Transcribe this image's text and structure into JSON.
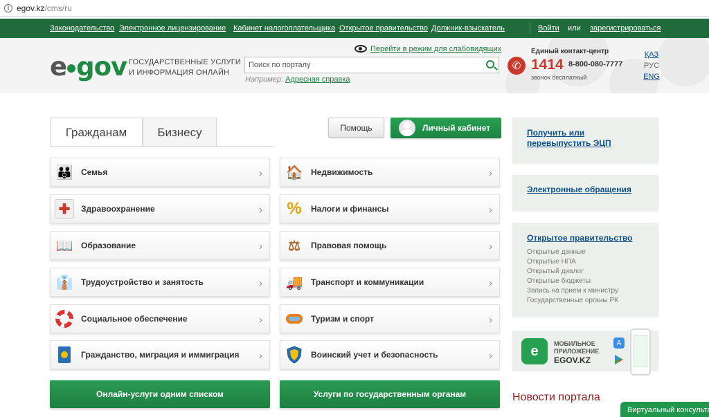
{
  "browser": {
    "domain": "egov.kz",
    "path": "/cms/ru"
  },
  "topnav": {
    "items": [
      "Законодательство",
      "Электронное лицензирование",
      "Кабинет налогоплательщика",
      "Открытое правительство",
      "Должник-взыскатель"
    ],
    "login": "Войти",
    "or": "или",
    "register": "зарегистрироваться"
  },
  "header": {
    "logo": {
      "e": "e",
      "gov": "gov"
    },
    "tagline_line1": "Государственные услуги",
    "tagline_line2": "и информация онлайн",
    "special_mode": "Перейти в режим для слабовидящих",
    "search": {
      "placeholder": "Поиск по порталу",
      "example_prefix": "Например:",
      "example_link": "Адресная справка"
    },
    "contact": {
      "title": "Единый контакт-центр",
      "number": "1414",
      "phone": "8-800-080-7777",
      "free": "звонок бесплатный"
    },
    "languages": [
      "ҚАЗ",
      "РУС",
      "ENG"
    ],
    "active_language": "РУС"
  },
  "tabs": [
    "Гражданам",
    "Бизнесу"
  ],
  "active_tab": "Гражданам",
  "actions": {
    "help": "Помощь",
    "cabinet": "Личный кабинет"
  },
  "categories": {
    "left": [
      "Семья",
      "Здравоохранение",
      "Образование",
      "Трудоустройство и занятость",
      "Социальное обеспечение",
      "Гражданство, миграция и иммиграция"
    ],
    "right": [
      "Недвижимость",
      "Налоги и финансы",
      "Правовая помощь",
      "Транспорт и коммуникации",
      "Туризм и спорт",
      "Воинский учет и безопасность"
    ]
  },
  "bottom_buttons": [
    "Онлайн-услуги одним списком",
    "Услуги по государственным органам"
  ],
  "sidebar": {
    "ecp": "Получить или перевыпустить ЭЦП",
    "appeals": "Электронные обращения",
    "open_gov": {
      "title": "Открытое правительство",
      "links": [
        "Открытые данные",
        "Открытые НПА",
        "Открытый диалог",
        "Открытые бюджеты",
        "Запись на прием к министру",
        "Государственные органы РК"
      ]
    },
    "app": {
      "title_line1": "МОБИЛЬНОЕ",
      "title_line2": "ПРИЛОЖЕНИЕ",
      "name": "EGOV.KZ"
    }
  },
  "news_title": "Новости портала",
  "virtual_consultant": "Виртуальный консультант",
  "colors": {
    "brand_green": "#1f8a43",
    "nav_green": "#1f6b3c",
    "link_blue": "#0d4e86",
    "accent_red": "#c8392b"
  }
}
